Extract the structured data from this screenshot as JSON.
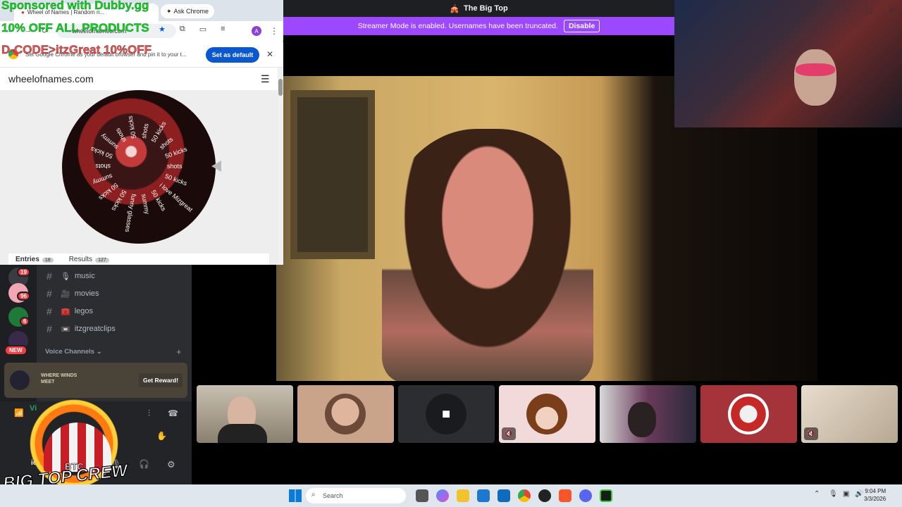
{
  "discord": {
    "title": "The Big Top",
    "streamer_mode_text": "Streamer Mode is enabled. Usernames have been truncated.",
    "disable_label": "Disable",
    "channels": [
      {
        "name": "music",
        "emoji": "🎙"
      },
      {
        "name": "movies",
        "emoji": "🎥"
      },
      {
        "name": "legos",
        "emoji": "🧰"
      },
      {
        "name": "itzgreatclips",
        "emoji": "📼"
      }
    ],
    "voice_channels_label": "Voice Channels",
    "promo_card": {
      "title": "WHERE WINDS MEET",
      "button": "Get Reward!"
    },
    "server_badges": [
      "19",
      "96",
      "6",
      "NEW"
    ],
    "voice_status": "Vi",
    "user_short": "ic"
  },
  "browser": {
    "tab_title": "Wheel of Names | Random n...",
    "ask_chrome": "Ask Chrome",
    "address": "wheelofnames.com",
    "default_text": "Set Google Chrome as your default browser and pin it to your t...",
    "set_default": "Set as default",
    "site_name": "wheelofnames.com",
    "entries_label": "Entries",
    "entries_count": "18",
    "results_label": "Results",
    "results_count": "127",
    "wheel_labels": [
      "shots",
      "50 kicks",
      "i love Mizgreat",
      "50 kicks",
      "summy",
      "funny glasses",
      "50 kicks",
      "50 kicks",
      "summy",
      "shots",
      "50 kicks",
      "summy",
      "shots",
      "50 kicks",
      "shots",
      "50 kicks",
      "shots",
      "50 kicks"
    ]
  },
  "promo": {
    "line1": "Sponsored with Dubby.gg",
    "line2": "10% OFF ALL PRODUCTS",
    "line3": "D-CODE>itzGreat 10%OFF"
  },
  "overlay_logo": "BIG TOP CREW",
  "overlay_logo_small": "BTC",
  "taskbar": {
    "search_placeholder": "Search",
    "time": "9:04 PM",
    "date": "3/3/2026"
  },
  "colors": {
    "streamer_banner": "#9b48ff",
    "promo_green": "#19d219",
    "set_default_blue": "#0b57d0",
    "badge_red": "#f23f43"
  }
}
